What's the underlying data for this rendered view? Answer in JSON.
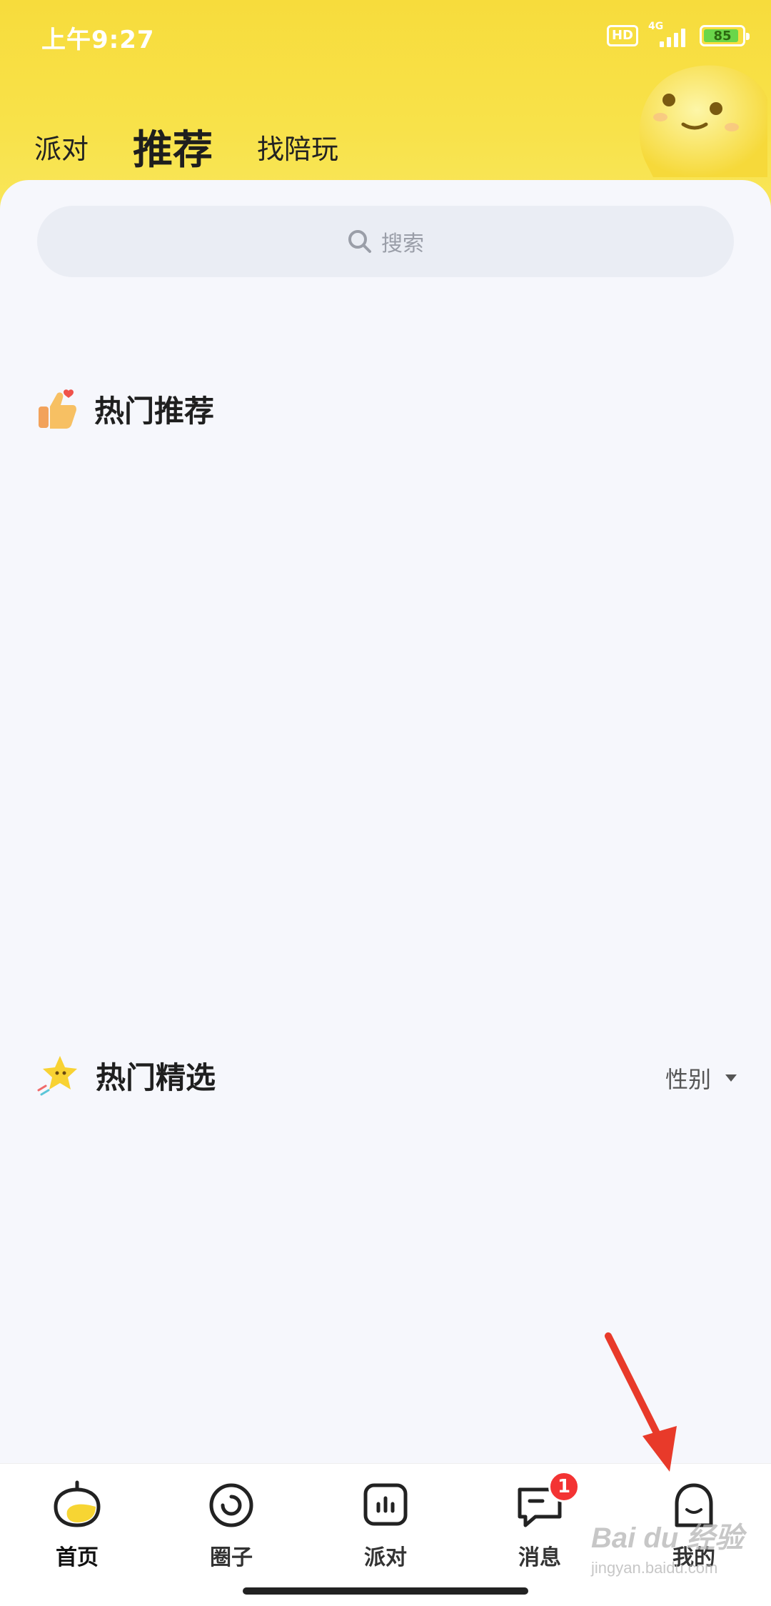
{
  "status_bar": {
    "time": "上午9:27",
    "hd": "HD",
    "network": "4G",
    "battery": "85"
  },
  "top_tabs": [
    {
      "label": "派对",
      "active": false
    },
    {
      "label": "推荐",
      "active": true
    },
    {
      "label": "找陪玩",
      "active": false
    }
  ],
  "search": {
    "placeholder": "搜索"
  },
  "sections": {
    "hot_recommend": "热门推荐",
    "hot_picks": "热门精选",
    "gender_filter": "性别"
  },
  "bottom_nav": [
    {
      "label": "首页",
      "icon": "home-icon",
      "active": true
    },
    {
      "label": "圈子",
      "icon": "circle-icon",
      "active": false
    },
    {
      "label": "派对",
      "icon": "party-icon",
      "active": false
    },
    {
      "label": "消息",
      "icon": "message-icon",
      "active": false,
      "badge": "1"
    },
    {
      "label": "我的",
      "icon": "profile-icon",
      "active": false
    }
  ],
  "watermark": {
    "brand": "Bai du 经验",
    "sub": "jingyan.baidu.com"
  },
  "colors": {
    "header_yellow": "#f7dc3c",
    "background": "#f6f7fc",
    "badge_red": "#f33333",
    "arrow_red": "#e83a2a"
  }
}
